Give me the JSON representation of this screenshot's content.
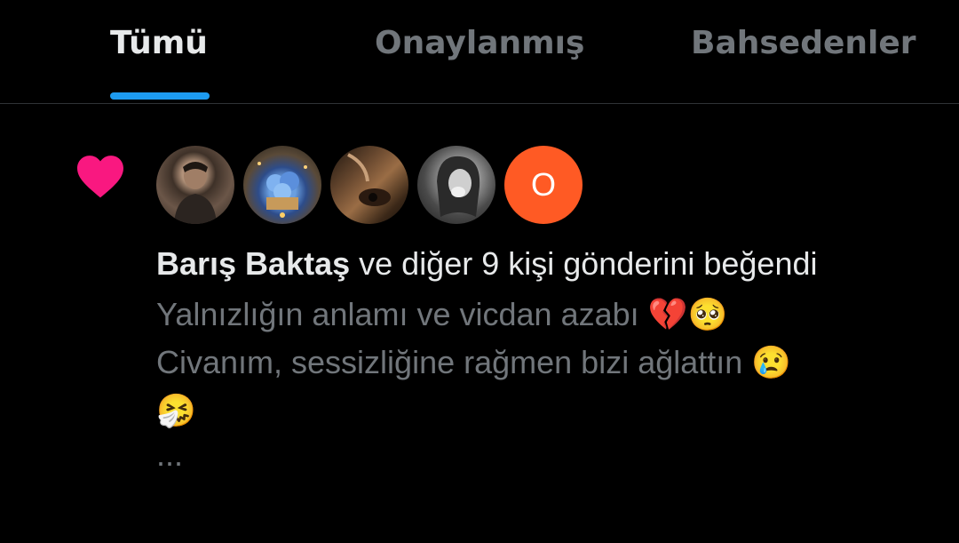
{
  "tabs": [
    {
      "label": "Tümü",
      "active": true
    },
    {
      "label": "Onaylanmış",
      "active": false
    },
    {
      "label": "Bahsedenler",
      "active": false
    }
  ],
  "colors": {
    "background": "#000000",
    "accent": "#1d9bf0",
    "heart": "#f91880",
    "muted_text": "#71767b",
    "primary_text": "#e7e9ea",
    "initial_avatar_bg": "#ff5a24"
  },
  "notification": {
    "type_icon": "heart-icon",
    "avatars": [
      {
        "kind": "photo"
      },
      {
        "kind": "photo"
      },
      {
        "kind": "photo"
      },
      {
        "kind": "photo"
      },
      {
        "kind": "initial",
        "initial": "O"
      }
    ],
    "liker_name": "Barış Baktaş",
    "liked_suffix": " ve diğer 9 kişi gönderini beğendi",
    "post_lines": [
      "Yalnızlığın anlamı ve vicdan azabı 💔🥺",
      "Civanım, sessizliğine rağmen bizi ağlattın 😢",
      "🤧"
    ],
    "truncation": "..."
  }
}
